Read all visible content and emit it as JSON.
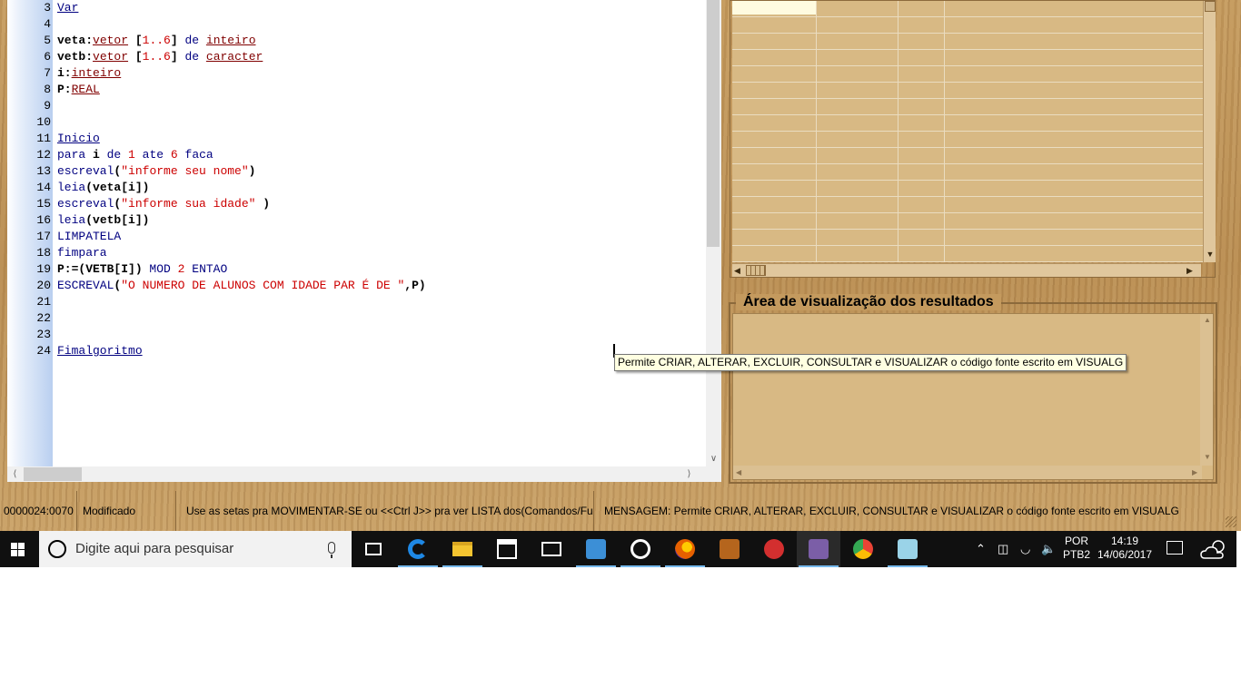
{
  "editor": {
    "lines": [
      {
        "n": "3",
        "parts": [
          {
            "t": "Var",
            "c": "kw-u"
          }
        ]
      },
      {
        "n": "4",
        "parts": []
      },
      {
        "n": "5",
        "parts": [
          {
            "t": "veta:",
            "c": "b"
          },
          {
            "t": "vetor",
            "c": "typ"
          },
          {
            "t": " [",
            "c": "b"
          },
          {
            "t": "1..6",
            "c": "num-c"
          },
          {
            "t": "] ",
            "c": "b"
          },
          {
            "t": "de",
            "c": "kw"
          },
          {
            "t": " ",
            "c": ""
          },
          {
            "t": "inteiro",
            "c": "typ"
          }
        ]
      },
      {
        "n": "6",
        "parts": [
          {
            "t": "vetb:",
            "c": "b"
          },
          {
            "t": "vetor",
            "c": "typ"
          },
          {
            "t": " [",
            "c": "b"
          },
          {
            "t": "1..6",
            "c": "num-c"
          },
          {
            "t": "] ",
            "c": "b"
          },
          {
            "t": "de",
            "c": "kw"
          },
          {
            "t": " ",
            "c": ""
          },
          {
            "t": "caracter",
            "c": "typ"
          }
        ]
      },
      {
        "n": "7",
        "parts": [
          {
            "t": "i:",
            "c": "b"
          },
          {
            "t": "inteiro",
            "c": "typ"
          }
        ]
      },
      {
        "n": "8",
        "parts": [
          {
            "t": "P:",
            "c": "b"
          },
          {
            "t": "REAL",
            "c": "typ"
          }
        ]
      },
      {
        "n": "9",
        "parts": []
      },
      {
        "n": "10",
        "parts": []
      },
      {
        "n": "11",
        "parts": [
          {
            "t": "Inicio",
            "c": "kw-u"
          }
        ]
      },
      {
        "n": "12",
        "parts": [
          {
            "t": "para",
            "c": "kw"
          },
          {
            "t": " i ",
            "c": "b"
          },
          {
            "t": "de",
            "c": "kw"
          },
          {
            "t": " ",
            "c": ""
          },
          {
            "t": "1",
            "c": "num-c"
          },
          {
            "t": " ",
            "c": ""
          },
          {
            "t": "ate",
            "c": "kw"
          },
          {
            "t": " ",
            "c": ""
          },
          {
            "t": "6",
            "c": "num-c"
          },
          {
            "t": " ",
            "c": ""
          },
          {
            "t": "faca",
            "c": "kw"
          }
        ]
      },
      {
        "n": "13",
        "parts": [
          {
            "t": "escreval",
            "c": "kw"
          },
          {
            "t": "(",
            "c": "b"
          },
          {
            "t": "\"informe seu nome\"",
            "c": "str"
          },
          {
            "t": ")",
            "c": "b"
          }
        ]
      },
      {
        "n": "14",
        "parts": [
          {
            "t": "leia",
            "c": "kw"
          },
          {
            "t": "(veta[i])",
            "c": "b"
          }
        ]
      },
      {
        "n": "15",
        "parts": [
          {
            "t": "escreval",
            "c": "kw"
          },
          {
            "t": "(",
            "c": "b"
          },
          {
            "t": "\"informe sua idade\"",
            "c": "str"
          },
          {
            "t": " )",
            "c": "b"
          }
        ]
      },
      {
        "n": "16",
        "parts": [
          {
            "t": "leia",
            "c": "kw"
          },
          {
            "t": "(vetb[i])",
            "c": "b"
          }
        ]
      },
      {
        "n": "17",
        "parts": [
          {
            "t": "LIMPATELA",
            "c": "kw"
          }
        ]
      },
      {
        "n": "18",
        "parts": [
          {
            "t": "fimpara",
            "c": "kw"
          }
        ]
      },
      {
        "n": "19",
        "parts": [
          {
            "t": "P:=(VETB[I]) ",
            "c": "b"
          },
          {
            "t": "MOD",
            "c": "kw"
          },
          {
            "t": " ",
            "c": ""
          },
          {
            "t": "2",
            "c": "num-c"
          },
          {
            "t": " ",
            "c": ""
          },
          {
            "t": "ENTAO",
            "c": "kw"
          }
        ]
      },
      {
        "n": "20",
        "parts": [
          {
            "t": "ESCREVAL",
            "c": "kw"
          },
          {
            "t": "(",
            "c": "b"
          },
          {
            "t": "\"O NUMERO DE ALUNOS COM IDADE PAR É DE \"",
            "c": "str"
          },
          {
            "t": ",P)",
            "c": "b"
          }
        ]
      },
      {
        "n": "21",
        "parts": []
      },
      {
        "n": "22",
        "parts": []
      },
      {
        "n": "23",
        "parts": []
      },
      {
        "n": "24",
        "parts": [
          {
            "t": "Fimalgoritmo",
            "c": "kw-u"
          }
        ]
      }
    ]
  },
  "results": {
    "title": "Área de visualização dos resultados"
  },
  "tooltip": {
    "text": "Permite CRIAR, ALTERAR, EXCLUIR, CONSULTAR e VISUALIZAR o código fonte escrito em VISUALG"
  },
  "statusbar": {
    "position": "0000024:0070",
    "state": "Modificado",
    "hint": "Use as setas pra MOVIMENTAR-SE ou <<Ctrl J>> pra ver LISTA dos(Comandos/Fu...",
    "message": "MENSAGEM: Permite CRIAR, ALTERAR, EXCLUIR, CONSULTAR e VISUALIZAR o código fonte escrito em VISUALG"
  },
  "taskbar": {
    "search_placeholder": "Digite aqui para pesquisar",
    "lang_top": "POR",
    "lang_bottom": "PTB2",
    "time": "14:19",
    "date": "14/06/2017",
    "apps": [
      {
        "name": "task-view-icon",
        "color": "#ffffff"
      },
      {
        "name": "edge-icon",
        "color": "#1e88e5"
      },
      {
        "name": "file-explorer-icon",
        "color": "#f4c430"
      },
      {
        "name": "store-icon",
        "color": "#ffffff"
      },
      {
        "name": "mail-icon",
        "color": "#ffffff"
      },
      {
        "name": "visual-studio-code-icon",
        "color": "#3c8fd6"
      },
      {
        "name": "media-player-icon",
        "color": "#ffffff"
      },
      {
        "name": "firefox-icon",
        "color": "#e66000"
      },
      {
        "name": "game-app-icon",
        "color": "#b5651d"
      },
      {
        "name": "flash-icon",
        "color": "#d32f2f"
      },
      {
        "name": "visualg-icon",
        "color": "#7b5ea7"
      },
      {
        "name": "chrome-icon",
        "color": "#34a853"
      },
      {
        "name": "notepad-app-icon",
        "color": "#9ad3e8"
      }
    ]
  }
}
